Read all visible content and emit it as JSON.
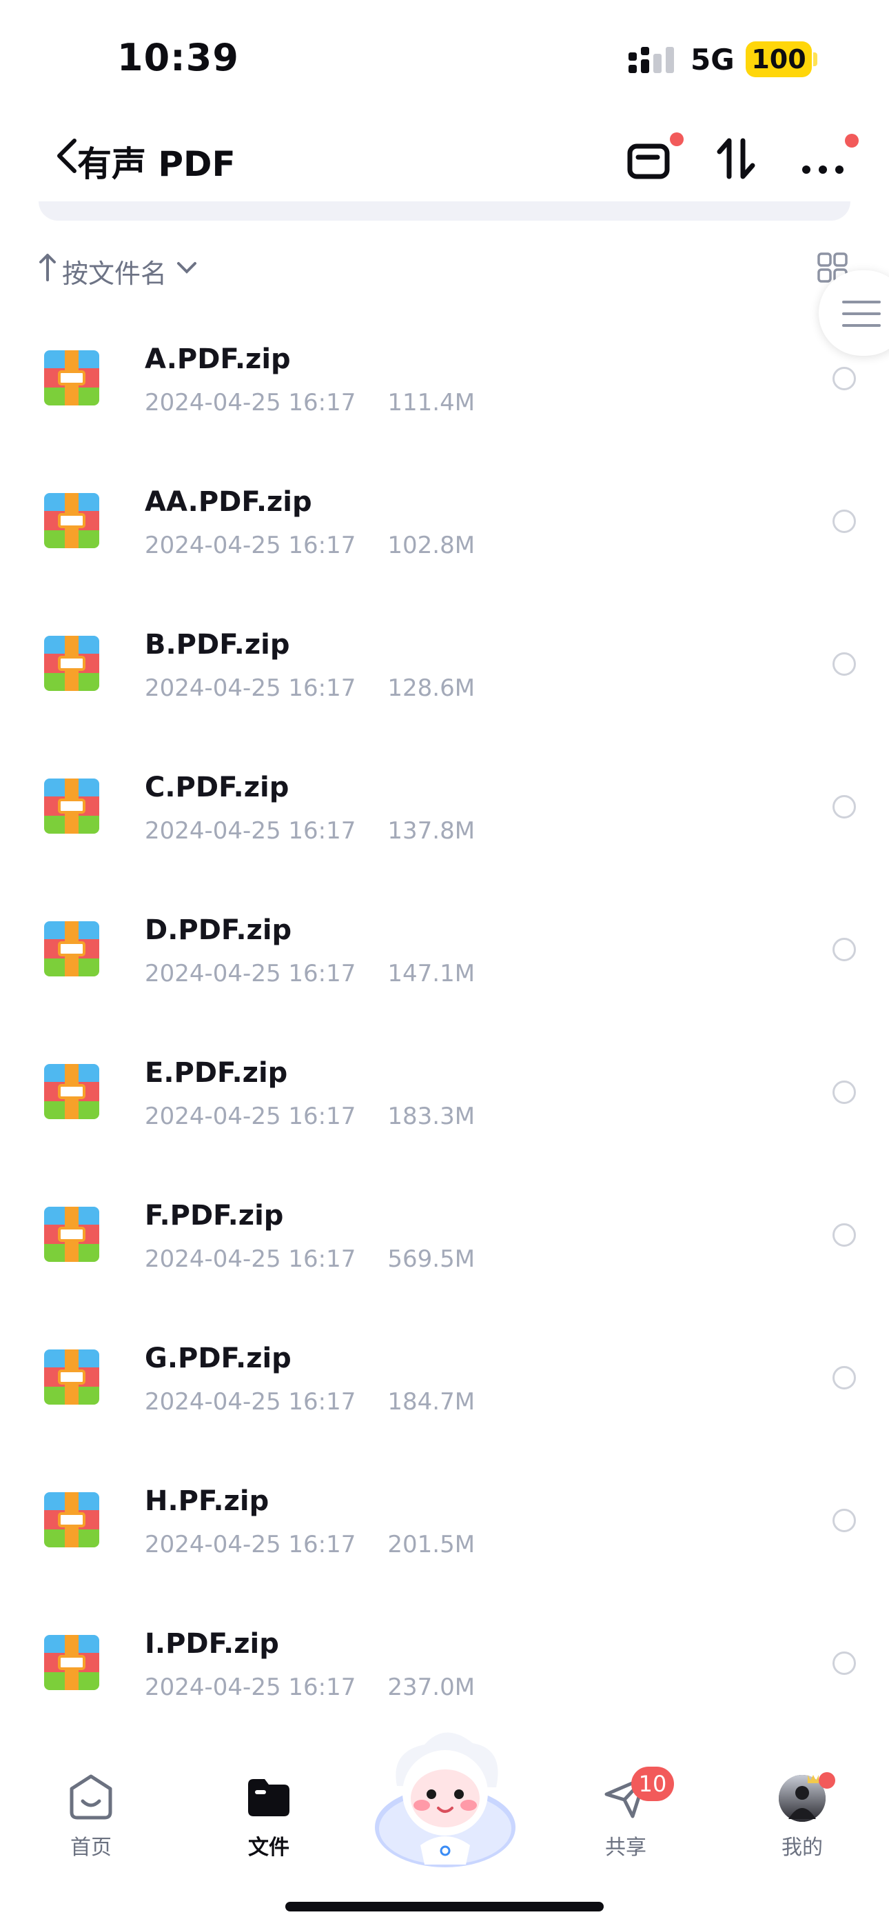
{
  "status_bar": {
    "time": "10:39",
    "network": "5G",
    "battery": "100"
  },
  "nav": {
    "title": "有声 PDF"
  },
  "sort": {
    "label": "按文件名"
  },
  "files": [
    {
      "name": "A.PDF.zip",
      "date": "2024-04-25 16:17",
      "size": "111.4M"
    },
    {
      "name": "AA.PDF.zip",
      "date": "2024-04-25 16:17",
      "size": "102.8M"
    },
    {
      "name": "B.PDF.zip",
      "date": "2024-04-25 16:17",
      "size": "128.6M"
    },
    {
      "name": "C.PDF.zip",
      "date": "2024-04-25 16:17",
      "size": "137.8M"
    },
    {
      "name": "D.PDF.zip",
      "date": "2024-04-25 16:17",
      "size": "147.1M"
    },
    {
      "name": "E.PDF.zip",
      "date": "2024-04-25 16:17",
      "size": "183.3M"
    },
    {
      "name": "F.PDF.zip",
      "date": "2024-04-25 16:17",
      "size": "569.5M"
    },
    {
      "name": "G.PDF.zip",
      "date": "2024-04-25 16:17",
      "size": "184.7M"
    },
    {
      "name": "H.PF.zip",
      "date": "2024-04-25 16:17",
      "size": "201.5M"
    },
    {
      "name": "I.PDF.zip",
      "date": "2024-04-25 16:17",
      "size": "237.0M"
    }
  ],
  "tabs": {
    "home": "首页",
    "files": "文件",
    "share": "共享",
    "share_badge": "10",
    "mine": "我的"
  },
  "colors": {
    "accent_red": "#f25a5a",
    "battery": "#ffd60a",
    "meta_gray": "#a3a9b8"
  }
}
